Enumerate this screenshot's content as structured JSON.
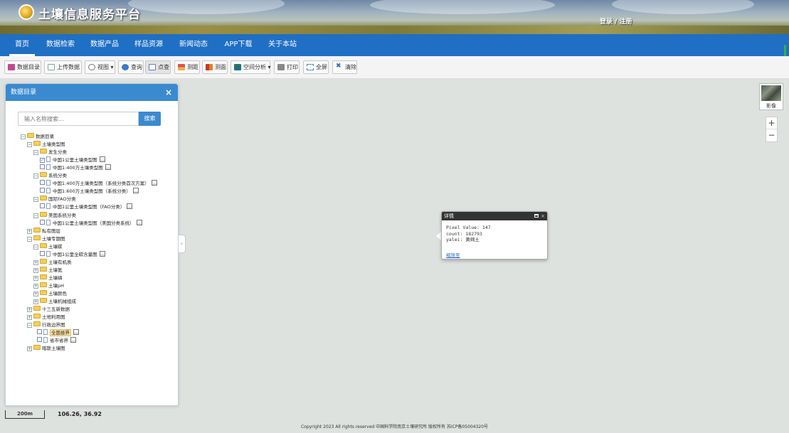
{
  "header": {
    "site_title": "土壤信息服务平台",
    "login": "登录",
    "separator": "/",
    "register": "注册"
  },
  "nav": {
    "items": [
      {
        "label": "首页",
        "active": true
      },
      {
        "label": "数据检索"
      },
      {
        "label": "数据产品"
      },
      {
        "label": "样品资源"
      },
      {
        "label": "新闻动态"
      },
      {
        "label": "APP下载"
      },
      {
        "label": "关于本站"
      }
    ]
  },
  "toolbar": {
    "catalog": "数据目录",
    "upload": "上传数据",
    "view": "视图",
    "query": "查询",
    "point_query": "点查",
    "distance": "测距",
    "area": "测面",
    "spatial_analysis": "空间分析",
    "print": "打印",
    "fullscreen": "全屏",
    "clear": "清除",
    "dropdown_arrow": "▾"
  },
  "panel": {
    "title": "数据目录",
    "close": "×",
    "search_placeholder": "输入名称搜索...",
    "search_button": "搜索",
    "collapse": "‹"
  },
  "tree": [
    {
      "label": "数据目录",
      "level": 0,
      "type": "folder",
      "exp": "−"
    },
    {
      "label": "土壤类型图",
      "level": 1,
      "type": "folder",
      "exp": "−"
    },
    {
      "label": "发生分类",
      "level": 2,
      "type": "folder",
      "exp": "−"
    },
    {
      "label": "中国1公里土壤类型图",
      "level": 3,
      "type": "leaf",
      "checked": true
    },
    {
      "label": "中国1:400万土壤类型图",
      "level": 3,
      "type": "leaf"
    },
    {
      "label": "系统分类",
      "level": 2,
      "type": "folder",
      "exp": "−"
    },
    {
      "label": "中国1:400万土壤类型图（系统分类首次方案）",
      "level": 3,
      "type": "leaf"
    },
    {
      "label": "中国1:600万土壤类型图（系统分类）",
      "level": 3,
      "type": "leaf"
    },
    {
      "label": "国际FAO分类",
      "level": 2,
      "type": "folder",
      "exp": "−"
    },
    {
      "label": "中国1公里土壤类型图（FAO分类）",
      "level": 3,
      "type": "leaf"
    },
    {
      "label": "美国系统分类",
      "level": 2,
      "type": "folder",
      "exp": "−"
    },
    {
      "label": "中国1公里土壤类型图（美国分类系统）",
      "level": 3,
      "type": "leaf"
    },
    {
      "label": "私有图层",
      "level": 1,
      "type": "folder",
      "exp": "+"
    },
    {
      "label": "土壤专题图",
      "level": 1,
      "type": "folder",
      "exp": "−"
    },
    {
      "label": "土壤碳",
      "level": 2,
      "type": "folder",
      "exp": "−"
    },
    {
      "label": "中国1公里全碳含量图",
      "level": 3,
      "type": "leaf"
    },
    {
      "label": "土壤有机质",
      "level": 2,
      "type": "folder",
      "exp": "+"
    },
    {
      "label": "土壤氮",
      "level": 2,
      "type": "folder",
      "exp": "+"
    },
    {
      "label": "土壤磷",
      "level": 2,
      "type": "folder",
      "exp": "+"
    },
    {
      "label": "土壤pH",
      "level": 2,
      "type": "folder",
      "exp": "+"
    },
    {
      "label": "土壤颜色",
      "level": 2,
      "type": "folder",
      "exp": "+"
    },
    {
      "label": "土壤机械组成",
      "level": 2,
      "type": "folder",
      "exp": "+"
    },
    {
      "label": "十三五新数据",
      "level": 1,
      "type": "folder",
      "exp": "+"
    },
    {
      "label": "土地利用图",
      "level": 1,
      "type": "folder",
      "exp": "+"
    },
    {
      "label": "行政边界图",
      "level": 1,
      "type": "folder",
      "exp": "−"
    },
    {
      "label": "全国县界",
      "level": 2,
      "type": "leaf",
      "highlight": true
    },
    {
      "label": "省市省界",
      "level": 2,
      "type": "leaf"
    },
    {
      "label": "喀斯土壤图",
      "level": 1,
      "type": "folder",
      "exp": "+"
    }
  ],
  "map": {
    "basemap_label": "影像",
    "zoom_in": "+",
    "zoom_out": "−",
    "scale_label": "200m",
    "coordinates": "106.26, 36.92"
  },
  "popup": {
    "title": "详情",
    "close": "×",
    "lines": [
      "Pixel Value: 147",
      "count: 182793",
      "yalei: 黄绵土"
    ],
    "zoom_link": "缩放至"
  },
  "footer": {
    "copyright": "Copyright 2023 All rights reserved 中国科学院南京土壤研究所 版权所有 苏ICP备05004320号"
  }
}
